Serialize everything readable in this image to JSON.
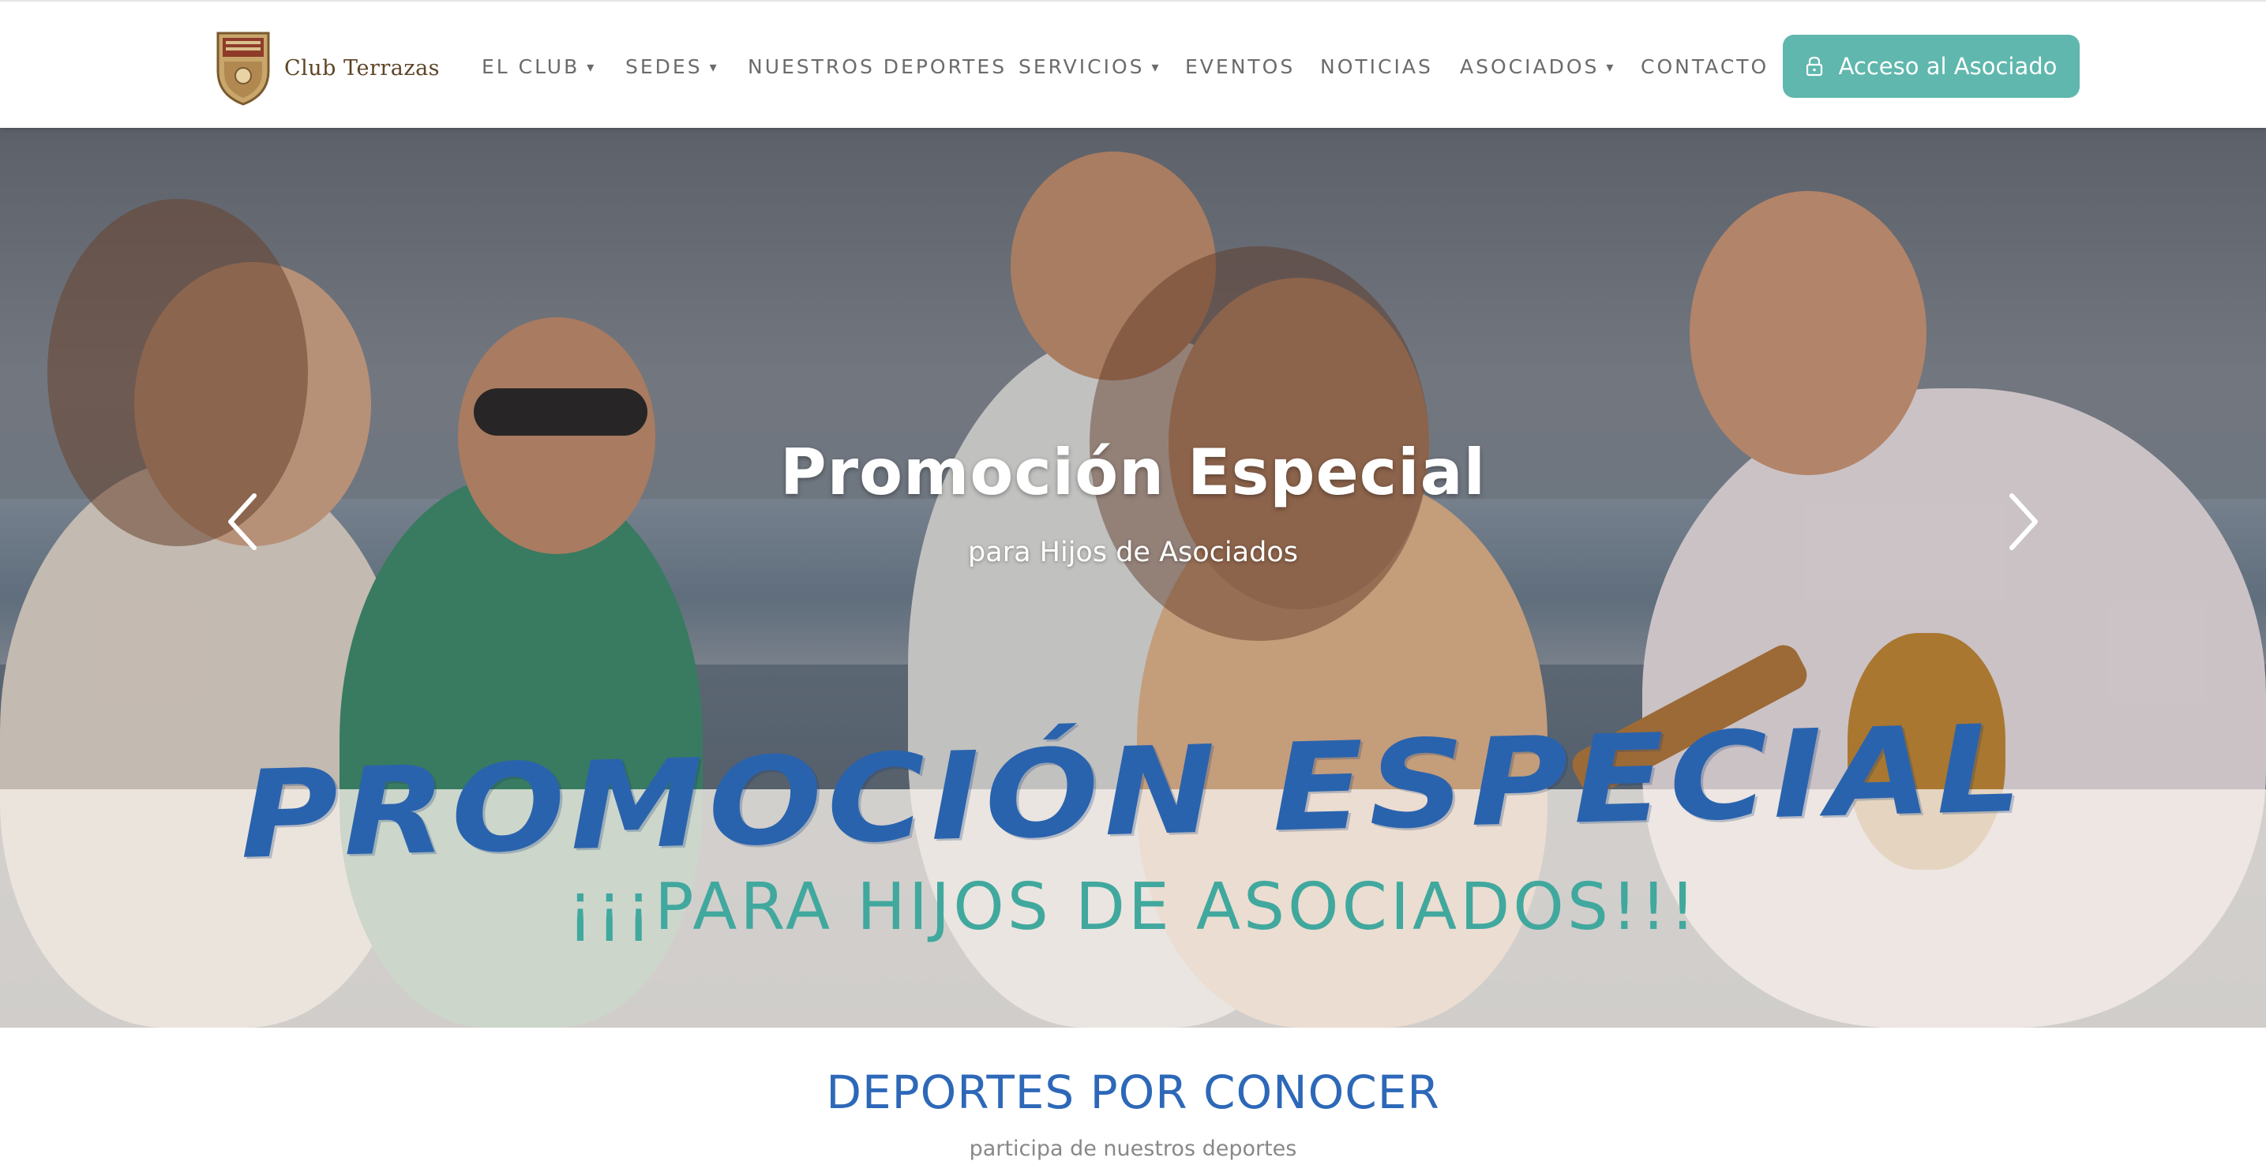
{
  "brand": {
    "name": "Club Terrazas",
    "logo_icon": "club-crest-icon"
  },
  "nav": {
    "items": [
      {
        "label": "EL CLUB",
        "caret": "▾"
      },
      {
        "label": "SEDES",
        "caret": "▾"
      },
      {
        "label": "NUESTROS DEPORTES",
        "caret": ""
      },
      {
        "label": "SERVICIOS",
        "caret": "▾"
      },
      {
        "label": "EVENTOS",
        "caret": ""
      },
      {
        "label": "NOTICIAS",
        "caret": ""
      },
      {
        "label": "ASOCIADOS",
        "caret": "▾"
      },
      {
        "label": "CONTACTO",
        "caret": ""
      }
    ],
    "cta": {
      "label": "Acceso al Asociado",
      "icon": "lock-icon"
    }
  },
  "hero": {
    "title": "Promoción Especial",
    "subtitle": "para Hijos de Asociados",
    "banner_title": "PROMOCIÓN ESPECIAL",
    "banner_subtitle": "¡¡¡PARA HIJOS DE ASOCIADOS!!!",
    "prev_icon": "chevron-left-icon",
    "next_icon": "chevron-right-icon"
  },
  "section": {
    "title": "DEPORTES POR CONOCER",
    "subtitle": "participa de nuestros deportes"
  },
  "colors": {
    "accent": "#5fb7ad",
    "heading_blue": "#2d68b8",
    "banner_blue": "#2a63ad",
    "banner_teal": "#41a89e",
    "nav_text": "#6b6b6b"
  }
}
